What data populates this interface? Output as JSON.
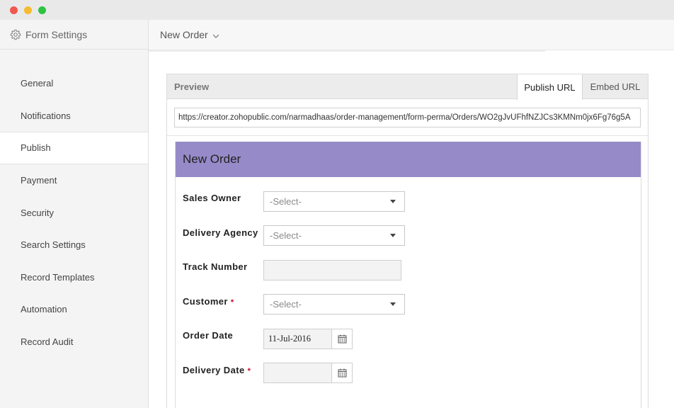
{
  "sidebar": {
    "title": "Form Settings",
    "items": [
      {
        "label": "General"
      },
      {
        "label": "Notifications"
      },
      {
        "label": "Publish"
      },
      {
        "label": "Payment"
      },
      {
        "label": "Security"
      },
      {
        "label": "Search Settings"
      },
      {
        "label": "Record Templates"
      },
      {
        "label": "Automation"
      },
      {
        "label": "Record Audit"
      }
    ],
    "active_item": "Publish"
  },
  "topbar": {
    "form_selector": "New Order"
  },
  "panel": {
    "title": "Preview",
    "tabs": [
      {
        "label": "Publish URL",
        "active": true
      },
      {
        "label": "Embed URL",
        "active": false
      }
    ],
    "url": "https://creator.zohopublic.com/narmadhaas/order-management/form-perma/Orders/WO2gJvUFhfNZJCs3KMNm0jx6Fg76g5A"
  },
  "form": {
    "title": "New Order",
    "header_color": "#968bc8",
    "fields": [
      {
        "label": "Sales Owner",
        "required": false,
        "type": "select",
        "value": "-Select-"
      },
      {
        "label": "Delivery Agency",
        "required": false,
        "type": "select",
        "value": "-Select-"
      },
      {
        "label": "Track Number",
        "required": false,
        "type": "text",
        "value": ""
      },
      {
        "label": "Customer",
        "required": true,
        "type": "select",
        "value": "-Select-"
      },
      {
        "label": "Order Date",
        "required": false,
        "type": "date",
        "value": "11-Jul-2016"
      },
      {
        "label": "Delivery Date",
        "required": true,
        "type": "date",
        "value": ""
      }
    ],
    "required_marker": "*"
  },
  "icons": {
    "settings": "gear-icon",
    "dropdown": "chevron-down-icon",
    "calendar": "calendar-icon"
  },
  "colors": {
    "required": "#d0021b",
    "window_close": "#f0584f",
    "window_minimize": "#f7bb2e",
    "window_zoom": "#2cc440"
  }
}
